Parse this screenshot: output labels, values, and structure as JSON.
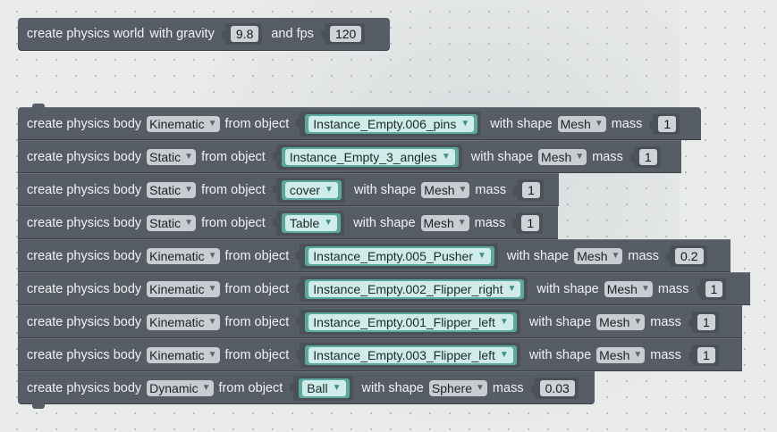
{
  "world": {
    "prefix": "create physics world",
    "gravity_label": "with gravity",
    "gravity": "9.8",
    "fps_label": "and fps",
    "fps": "120"
  },
  "labels": {
    "create_body": "create physics body",
    "from_object": "from object",
    "with_shape": "with shape",
    "mass": "mass",
    "arrow": "▼"
  },
  "bodies": [
    {
      "type": "Kinematic",
      "object": "Instance_Empty.006_pins",
      "shape": "Mesh",
      "mass": "1"
    },
    {
      "type": "Static",
      "object": "Instance_Empty_3_angles",
      "shape": "Mesh",
      "mass": "1"
    },
    {
      "type": "Static",
      "object": "cover",
      "shape": "Mesh",
      "mass": "1"
    },
    {
      "type": "Static",
      "object": "Table",
      "shape": "Mesh",
      "mass": "1"
    },
    {
      "type": "Kinematic",
      "object": "Instance_Empty.005_Pusher",
      "shape": "Mesh",
      "mass": "0.2"
    },
    {
      "type": "Kinematic",
      "object": "Instance_Empty.002_Flipper_right",
      "shape": "Mesh",
      "mass": "1"
    },
    {
      "type": "Kinematic",
      "object": "Instance_Empty.001_Flipper_left",
      "shape": "Mesh",
      "mass": "1"
    },
    {
      "type": "Kinematic",
      "object": "Instance_Empty.003_Flipper_left",
      "shape": "Mesh",
      "mass": "1"
    },
    {
      "type": "Dynamic",
      "object": "Ball",
      "shape": "Sphere",
      "mass": "0.03"
    }
  ]
}
